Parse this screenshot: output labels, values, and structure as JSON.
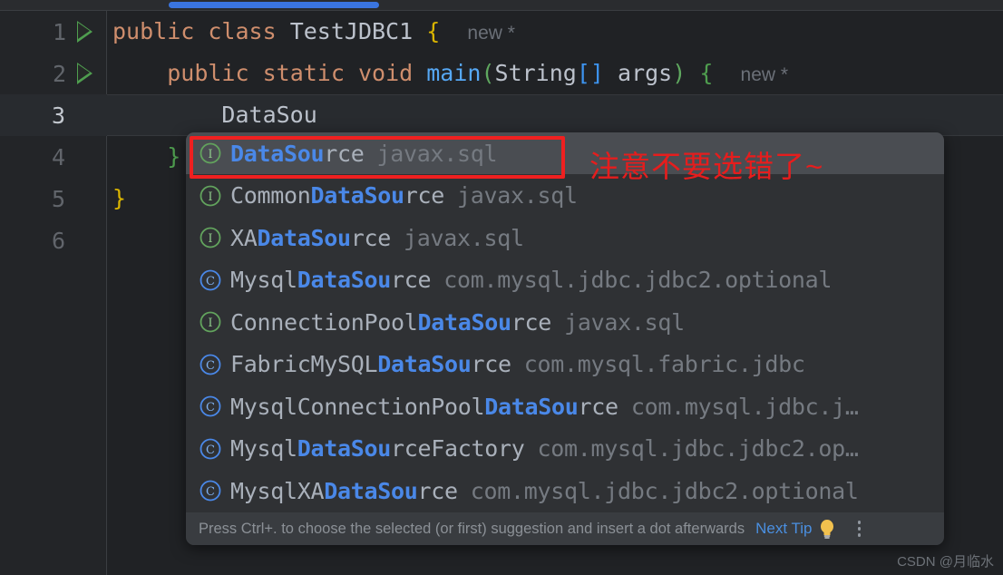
{
  "editor": {
    "lines": [
      {
        "num": "1",
        "has_run": true,
        "active": false
      },
      {
        "num": "2",
        "has_run": true,
        "active": false
      },
      {
        "num": "3",
        "has_run": false,
        "active": true
      },
      {
        "num": "4",
        "has_run": false,
        "active": false
      },
      {
        "num": "5",
        "has_run": false,
        "active": false
      },
      {
        "num": "6",
        "has_run": false,
        "active": false
      }
    ],
    "code": {
      "line1": {
        "kw_public": "public",
        "kw_class": "class",
        "classname": "TestJDBC1",
        "brace": "{",
        "inlay": "new *"
      },
      "line2": {
        "indent": "    ",
        "kw_public": "public",
        "kw_static": "static",
        "kw_void": "void",
        "method": "main",
        "lparen": "(",
        "param_type": "String",
        "brackets": "[]",
        "param_name": "args",
        "rparen": ")",
        "brace": "{",
        "inlay": "new *"
      },
      "line3": {
        "indent": "        ",
        "text": "DataSou"
      },
      "line4": {
        "indent": "    ",
        "brace": "}"
      },
      "line5": {
        "brace": "}"
      },
      "line6": {
        "text": ""
      }
    }
  },
  "completion_popup": {
    "items": [
      {
        "icon": "interface-icon",
        "icon_kind": "interface",
        "prefix": "",
        "match": "DataSou",
        "suffix": "rce",
        "package": "javax.sql",
        "selected": true
      },
      {
        "icon": "interface-icon",
        "icon_kind": "interface",
        "prefix": "Common",
        "match": "DataSou",
        "suffix": "rce",
        "package": "javax.sql",
        "selected": false
      },
      {
        "icon": "interface-icon",
        "icon_kind": "interface",
        "prefix": "XA",
        "match": "DataSou",
        "suffix": "rce",
        "package": "javax.sql",
        "selected": false
      },
      {
        "icon": "class-icon",
        "icon_kind": "class",
        "prefix": "Mysql",
        "match": "DataSou",
        "suffix": "rce",
        "package": "com.mysql.jdbc.jdbc2.optional",
        "selected": false
      },
      {
        "icon": "interface-icon",
        "icon_kind": "interface",
        "prefix": "ConnectionPool",
        "match": "DataSou",
        "suffix": "rce",
        "package": "javax.sql",
        "selected": false
      },
      {
        "icon": "class-icon",
        "icon_kind": "class",
        "prefix": "FabricMySQL",
        "match": "DataSou",
        "suffix": "rce",
        "package": "com.mysql.fabric.jdbc",
        "selected": false
      },
      {
        "icon": "class-icon",
        "icon_kind": "class",
        "prefix": "MysqlConnectionPool",
        "match": "DataSou",
        "suffix": "rce",
        "package": "com.mysql.jdbc.j…",
        "selected": false
      },
      {
        "icon": "class-icon",
        "icon_kind": "class",
        "prefix": "Mysql",
        "match": "DataSou",
        "suffix": "rceFactory",
        "package": "com.mysql.jdbc.jdbc2.op…",
        "selected": false
      },
      {
        "icon": "class-icon",
        "icon_kind": "class",
        "prefix": "MysqlXA",
        "match": "DataSou",
        "suffix": "rce",
        "package": "com.mysql.jdbc.jdbc2.optional",
        "selected": false
      }
    ],
    "footer": {
      "hint": "Press Ctrl+. to choose the selected (or first) suggestion and insert a dot afterwards",
      "next_tip": "Next Tip",
      "bulb_icon": "lightbulb-icon",
      "more_icon": "kebab-menu-icon"
    }
  },
  "annotation": {
    "note": "注意不要选错了~",
    "color": "#e61d1d"
  },
  "watermark": {
    "text": "CSDN @月临水"
  },
  "colors": {
    "accent_blue": "#3a75e0",
    "editor_bg": "#202225",
    "popup_bg": "#2f3134",
    "selected_row": "#4a4d52",
    "interface_icon": "#62a35d",
    "class_icon": "#4a88e8",
    "annotation_red": "#e61d1d"
  }
}
